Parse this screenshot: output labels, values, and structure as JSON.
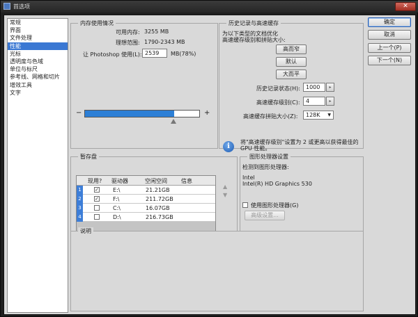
{
  "window": {
    "title": "首选项",
    "close_glyph": "✕"
  },
  "categories": [
    {
      "label": "常规"
    },
    {
      "label": "界面"
    },
    {
      "label": "文件处理"
    },
    {
      "label": "性能",
      "selected": true
    },
    {
      "label": "光标"
    },
    {
      "label": "透明度与色域"
    },
    {
      "label": "单位与标尺"
    },
    {
      "label": "参考线、网格和切片"
    },
    {
      "label": "增效工具"
    },
    {
      "label": "文字"
    }
  ],
  "memory": {
    "title": "内存使用情况",
    "available_label": "可用内存:",
    "available_value": "3255 MB",
    "ideal_label": "理想范围:",
    "ideal_value": "1790-2343 MB",
    "use_label": "让 Photoshop 使用(L):",
    "use_value": "2539",
    "use_unit": "MB(78%)",
    "slider_fraction": 0.78,
    "minus": "−",
    "plus": "+"
  },
  "history": {
    "title": "历史记录与高速缓存",
    "desc_line1": "为以下类型的文档优化",
    "desc_line2": "高速缓存级别和拼贴大小:",
    "btn_tall": "高而窄",
    "btn_default": "默认",
    "btn_big": "大而平",
    "states_label": "历史记录状态(H):",
    "states_value": "1000",
    "levels_label": "高速缓存级别(C):",
    "levels_value": "4",
    "tile_label": "高速缓存拼贴大小(Z):",
    "tile_value": "128K",
    "tip_line1": "将\"高速缓存级别\"设置为 2 或更高以获得最佳的",
    "tip_line2": "GPU 性能。"
  },
  "scratch": {
    "title": "暂存盘",
    "headers": [
      "现用?",
      "驱动器",
      "空闲空间",
      "信息"
    ],
    "rows": [
      {
        "num": "1",
        "checked": "✓",
        "drive": "E:\\",
        "free": "21.21GB"
      },
      {
        "num": "2",
        "checked": "✓",
        "drive": "F:\\",
        "free": "211.72GB"
      },
      {
        "num": "3",
        "checked": "",
        "drive": "C:\\",
        "free": "16.07GB"
      },
      {
        "num": "4",
        "checked": "",
        "drive": "D:\\",
        "free": "216.73GB"
      }
    ]
  },
  "gpu": {
    "title": "图形处理器设置",
    "detected_label": "检测到图形处理器:",
    "vendor": "Intel",
    "model": "Intel(R) HD Graphics 530",
    "use_gpu_label": "使用图形处理器(G)",
    "advanced_label": "高级设置..."
  },
  "description": {
    "title": "说明"
  },
  "buttons": {
    "ok": "确定",
    "cancel": "取消",
    "prev": "上一个(P)",
    "next": "下一个(N)"
  },
  "glyphs": {
    "up": "▲",
    "down": "▼",
    "spin": "▸",
    "dropdown": "▼",
    "info": "i"
  },
  "colors": {
    "accent": "#3b78d3",
    "slider": "#2c7fd6"
  }
}
